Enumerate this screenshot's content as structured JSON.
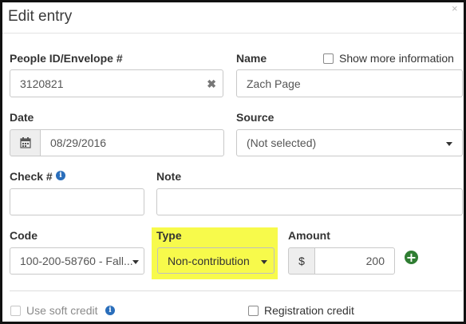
{
  "modal": {
    "title": "Edit entry",
    "close_glyph": "×"
  },
  "people_id": {
    "label": "People ID/Envelope #",
    "value": "3120821",
    "clear_glyph": "✖"
  },
  "name": {
    "label": "Name",
    "value": "Zach Page",
    "show_more_label": "Show more information"
  },
  "date": {
    "label": "Date",
    "value": "08/29/2016",
    "icon": "calendar-icon"
  },
  "source": {
    "label": "Source",
    "value": "(Not selected)"
  },
  "check": {
    "label": "Check #",
    "value": "",
    "icon": "info-icon"
  },
  "note": {
    "label": "Note",
    "value": ""
  },
  "code": {
    "label": "Code",
    "value": "100-200-58760 - Fall..."
  },
  "type": {
    "label": "Type",
    "value": "Non-contribution",
    "highlight_color": "#f7fa4b"
  },
  "amount": {
    "label": "Amount",
    "currency": "$",
    "value": "200",
    "add_icon": "plus-circle-icon",
    "add_color": "#2f7d32"
  },
  "footer": {
    "soft_credit_label": "Use soft credit",
    "registration_credit_label": "Registration credit"
  },
  "colors": {
    "info_icon": "#2a6ebb"
  }
}
